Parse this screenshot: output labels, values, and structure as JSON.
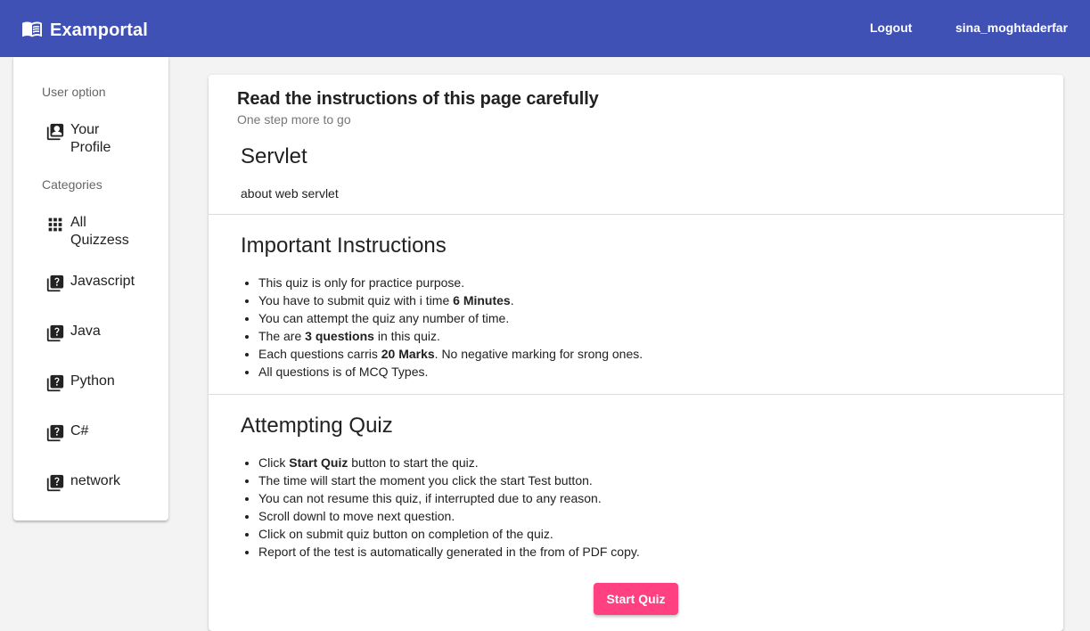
{
  "header": {
    "brand": "Examportal",
    "brand_icon": "book-open-icon",
    "logout_label": "Logout",
    "username": "sina_moghtaderfar",
    "bg_color": "#3f51b5"
  },
  "sidebar": {
    "user_option_label": "User option",
    "profile_label_line1": "Your",
    "profile_label_line2": "Profile",
    "categories_label": "Categories",
    "all_label_line1": "All",
    "all_label_line2": "Quizzess",
    "items": [
      {
        "label": "Javascript",
        "icon": "quiz-icon"
      },
      {
        "label": "Java",
        "icon": "quiz-icon"
      },
      {
        "label": "Python",
        "icon": "quiz-icon"
      },
      {
        "label": "C#",
        "icon": "quiz-icon"
      },
      {
        "label": "network",
        "icon": "quiz-icon"
      }
    ]
  },
  "card": {
    "title": "Read the instructions of this page carefully",
    "subtitle": "One step more to go",
    "quiz_title": "Servlet",
    "quiz_description": "about web servlet",
    "instructions_heading": "Important Instructions",
    "instructions": [
      {
        "pre": "This quiz is only for practice purpose.",
        "bold": "",
        "post": ""
      },
      {
        "pre": "You have to submit quiz with i time ",
        "bold": "6 Minutes",
        "post": "."
      },
      {
        "pre": "You can attempt the quiz any number of time.",
        "bold": "",
        "post": ""
      },
      {
        "pre": "The are ",
        "bold": "3 questions",
        "post": " in this quiz."
      },
      {
        "pre": "Each questions carris ",
        "bold": "20 Marks",
        "post": ". No negative marking for srong ones."
      },
      {
        "pre": "All questions is of MCQ Types.",
        "bold": "",
        "post": ""
      }
    ],
    "attempting_heading": "Attempting Quiz",
    "attempting": [
      {
        "pre": "Click ",
        "bold": "Start Quiz",
        "post": " button to start the quiz."
      },
      {
        "pre": "The time will start the moment you click the start Test button.",
        "bold": "",
        "post": ""
      },
      {
        "pre": "You can not resume this quiz, if interrupted due to any reason.",
        "bold": "",
        "post": ""
      },
      {
        "pre": "Scroll downl to move next question.",
        "bold": "",
        "post": ""
      },
      {
        "pre": "Click on submit quiz button on completion of the quiz.",
        "bold": "",
        "post": ""
      },
      {
        "pre": "Report of the test is automatically generated in the from of PDF copy.",
        "bold": "",
        "post": ""
      }
    ],
    "start_button": "Start Quiz",
    "accent_color": "#ff4081"
  }
}
